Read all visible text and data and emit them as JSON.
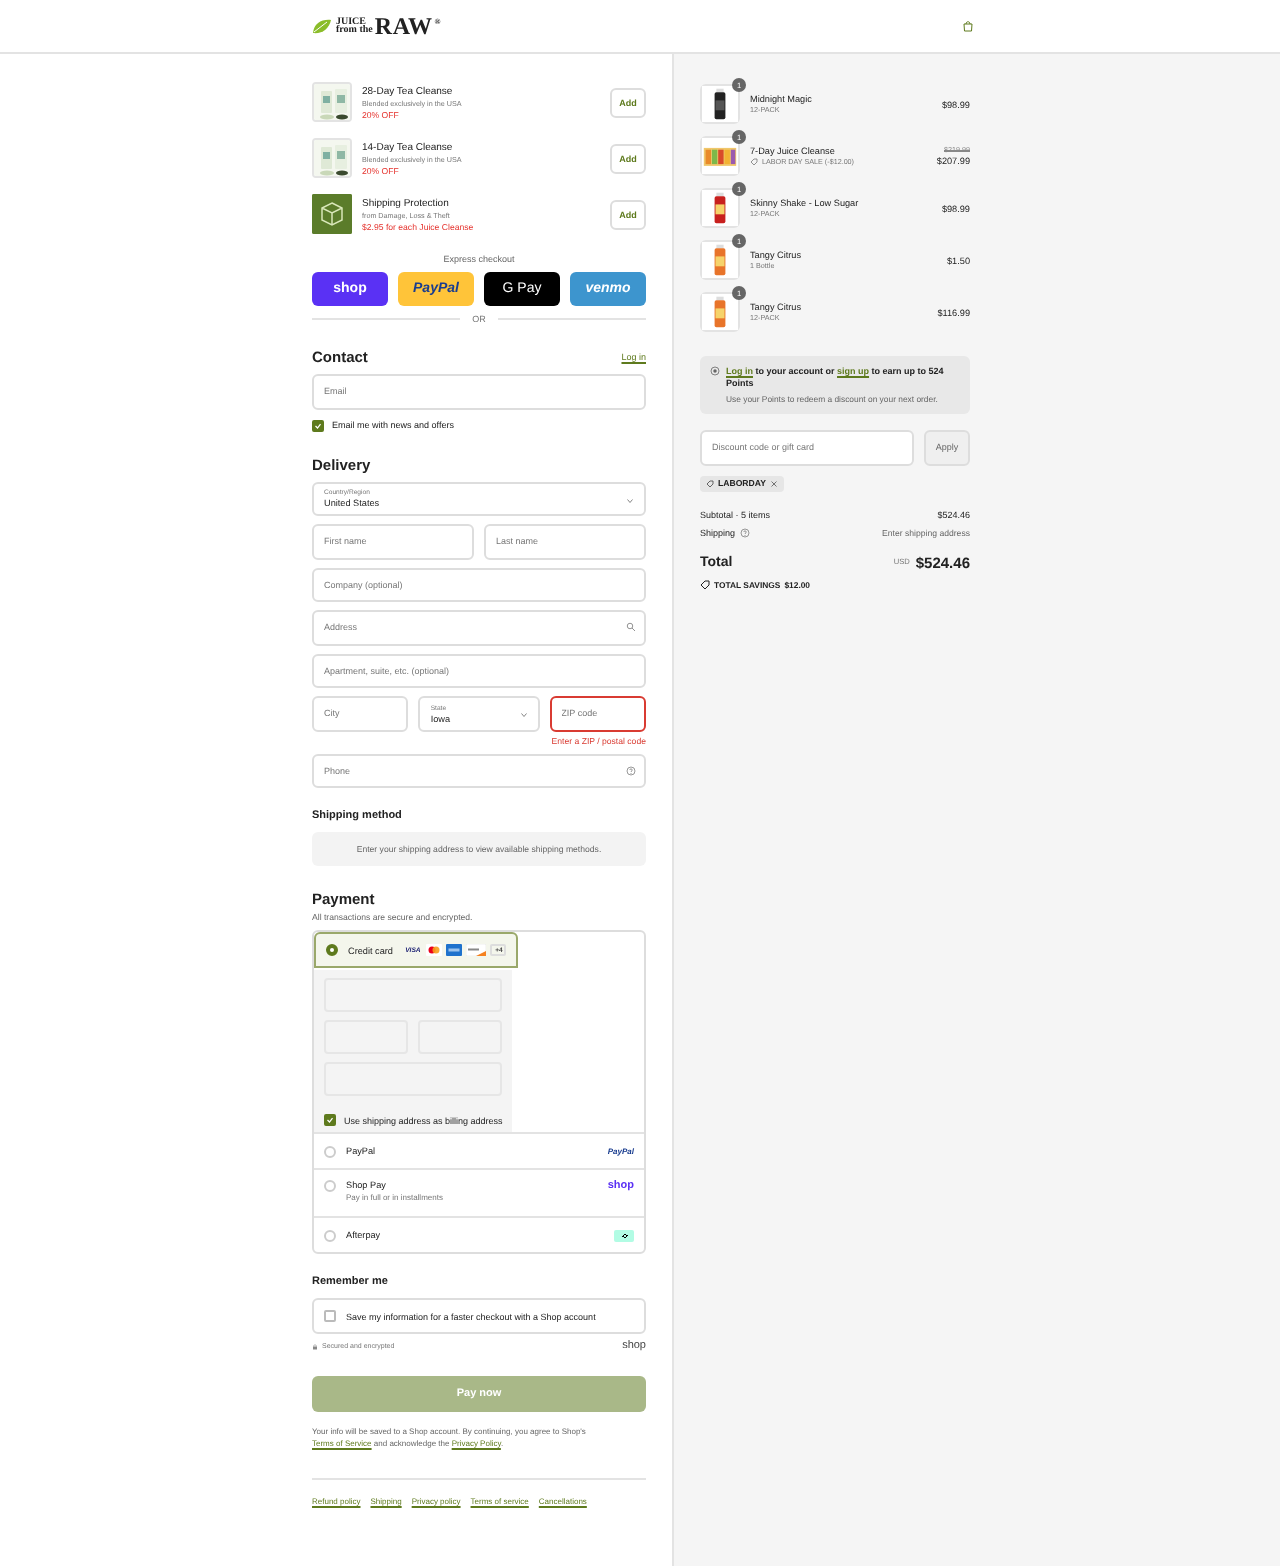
{
  "header": {
    "logo_words": [
      "JUICE",
      "from the",
      "RAW"
    ],
    "logo_mark": "®"
  },
  "upsells": [
    {
      "title": "28-Day Tea Cleanse",
      "subtitle": "Blended exclusively in the USA",
      "offer": "20% OFF",
      "button": "Add",
      "kind": "product"
    },
    {
      "title": "14-Day Tea Cleanse",
      "subtitle": "Blended exclusively in the USA",
      "offer": "20% OFF",
      "button": "Add",
      "kind": "product"
    },
    {
      "title": "Shipping Protection",
      "subtitle": "from Damage, Loss & Theft",
      "offer": "$2.95 for each Juice Cleanse",
      "button": "Add",
      "kind": "protection"
    }
  ],
  "express_checkout": {
    "label": "Express checkout",
    "buttons": [
      {
        "kind": "shop",
        "label": "shop"
      },
      {
        "kind": "paypal",
        "label": "PayPal"
      },
      {
        "kind": "gpay",
        "label": "G Pay"
      },
      {
        "kind": "venmo",
        "label": "venmo"
      }
    ],
    "divider": "OR"
  },
  "contact": {
    "heading": "Contact",
    "login_link": "Log in",
    "email": {
      "placeholder": "Email"
    },
    "newsletter": {
      "label": "Email me with news and offers",
      "checked": true
    }
  },
  "delivery": {
    "heading": "Delivery",
    "rows": [
      [
        {
          "kind": "select",
          "label": "Country/Region",
          "value": "United States"
        }
      ],
      [
        {
          "kind": "input",
          "placeholder": "First name"
        },
        {
          "kind": "input",
          "placeholder": "Last name"
        }
      ],
      [
        {
          "kind": "input",
          "placeholder": "Company (optional)"
        }
      ],
      [
        {
          "kind": "address",
          "placeholder": "Address"
        }
      ],
      [
        {
          "kind": "input",
          "placeholder": "Apartment, suite, etc. (optional)"
        }
      ],
      [
        {
          "kind": "input",
          "placeholder": "City"
        },
        {
          "kind": "select",
          "label": "State",
          "value": "Iowa"
        },
        {
          "kind": "input",
          "placeholder": "ZIP code",
          "invalid": true,
          "error": "Enter a ZIP / postal code"
        }
      ],
      [
        {
          "kind": "phone",
          "placeholder": "Phone"
        }
      ]
    ]
  },
  "shipping_method": {
    "heading": "Shipping method",
    "notice": "Enter your shipping address to view available shipping methods."
  },
  "payment": {
    "heading": "Payment",
    "subtitle": "All transactions are secure and encrypted.",
    "methods": [
      {
        "kind": "card",
        "label": "Credit card",
        "selected": true,
        "brands": [
          {
            "kind": "visa",
            "label": "VISA"
          },
          {
            "kind": "mastercard"
          },
          {
            "kind": "amex"
          },
          {
            "kind": "discover"
          },
          {
            "kind": "more",
            "label": "+4"
          }
        ],
        "billing": {
          "label": "Use shipping address as billing address",
          "checked": true
        }
      },
      {
        "kind": "paypal",
        "label": "PayPal",
        "selected": false,
        "logo": "PayPal"
      },
      {
        "kind": "shop",
        "label": "Shop Pay",
        "sublabel": "Pay in full or in installments",
        "selected": false,
        "logo": "shop"
      },
      {
        "kind": "afterpay",
        "label": "Afterpay",
        "selected": false
      }
    ]
  },
  "remember_me": {
    "heading": "Remember me",
    "label": "Save my information for a faster checkout with a Shop account",
    "checked": false,
    "secure": "Secured and encrypted",
    "shop_logo": "shop"
  },
  "pay_button": {
    "label": "Pay now",
    "disabled": true
  },
  "legal_note": [
    {
      "text": "Your info will be saved to a Shop account. By continuing, you agree to Shop's "
    },
    {
      "text": "Terms of Service",
      "link": true
    },
    {
      "text": " and acknowledge the "
    },
    {
      "text": "Privacy Policy",
      "link": true
    },
    {
      "text": "."
    }
  ],
  "footer_links": [
    "Refund policy",
    "Shipping",
    "Privacy policy",
    "Terms of service",
    "Cancellations"
  ],
  "order_items": [
    {
      "name": "Midnight Magic",
      "variant": "12-PACK",
      "price": "$98.99",
      "quantity": "1"
    },
    {
      "name": "7-Day Juice Cleanse",
      "discount": "LABOR DAY SALE (-$12.00)",
      "original_price": "$219.99",
      "price": "$207.99",
      "quantity": "1"
    },
    {
      "name": "Skinny Shake - Low Sugar",
      "variant": "12-PACK",
      "price": "$98.99",
      "quantity": "1"
    },
    {
      "name": "Tangy Citrus",
      "variant": "1 Bottle",
      "price": "$1.50",
      "quantity": "1"
    },
    {
      "name": "Tangy Citrus",
      "variant": "12-PACK",
      "price": "$116.99",
      "quantity": "1"
    }
  ],
  "points": {
    "line_1": [
      {
        "text": "Log in",
        "link": true
      },
      {
        "text": " to your account or "
      },
      {
        "text": "sign up",
        "link": true
      },
      {
        "text": " to earn up to 524 Points"
      }
    ],
    "line_2": "Use your Points to redeem a discount on your next order."
  },
  "discount": {
    "placeholder": "Discount code or gift card",
    "button": "Apply",
    "applied_code": "LABORDAY"
  },
  "summary": {
    "subtotal_label": "Subtotal · 5 items",
    "subtotal": "$524.46",
    "shipping_label": "Shipping",
    "shipping": "Enter shipping address",
    "total_label": "Total",
    "currency": "USD",
    "total": "$524.46",
    "savings_label": "TOTAL SAVINGS",
    "savings": "$12.00"
  }
}
